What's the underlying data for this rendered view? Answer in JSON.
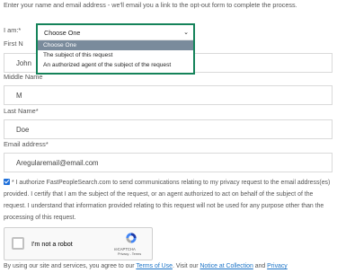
{
  "intro_text": "Enter your name and email address - we'll email you a link to the opt-out form to complete the process.",
  "i_am": {
    "label": "I am:*",
    "selected": "Choose One",
    "options": [
      "Choose One",
      "The subject of this request",
      "An authorized agent of the subject of the request"
    ]
  },
  "first_name": {
    "label": "First N",
    "value": "John"
  },
  "middle_name": {
    "label": "Middle Name",
    "value": "M"
  },
  "last_name": {
    "label": "Last Name*",
    "value": "Doe"
  },
  "email": {
    "label": "Email address*",
    "value": "Aregularemail@email.com"
  },
  "authorization": {
    "checked": true,
    "text": "* I authorize FastPeopleSearch.com to send communications relating to my privacy request to the email address(es) provided. I certify that I am the subject of the request, or an agent authorized to act on behalf of the subject of the request. I understand that information provided relating to this request will not be used for any purpose other than the processing of this request."
  },
  "recaptcha": {
    "label": "I'm not a robot",
    "brand": "reCAPTCHA",
    "links": "Privacy - Terms"
  },
  "footer": {
    "prefix": "By using our site and services, you agree to our ",
    "terms_link": "Terms of Use",
    "middle": ". Visit our ",
    "notice_link": "Notice at Collection",
    "and": " and ",
    "privacy_link": "Privacy"
  },
  "colors": {
    "highlight_border": "#15835a",
    "checkbox": "#1e6fd9",
    "link": "#1a73c7"
  }
}
